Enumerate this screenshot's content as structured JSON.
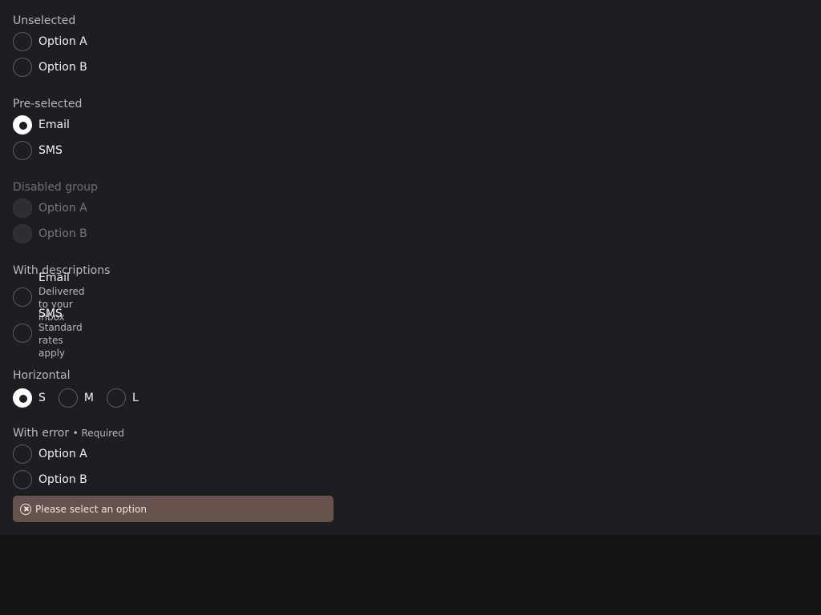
{
  "groups": {
    "unselected": {
      "label": "Unselected",
      "options": [
        "Option A",
        "Option B"
      ]
    },
    "preselected": {
      "label": "Pre-selected",
      "options": [
        "Email",
        "SMS"
      ],
      "selected": "Email"
    },
    "disabled": {
      "label": "Disabled group",
      "options": [
        "Option A",
        "Option B"
      ]
    },
    "descriptions": {
      "label": "With descriptions",
      "options": [
        {
          "title": "Email",
          "desc": "Delivered to your inbox"
        },
        {
          "title": "SMS",
          "desc": "Standard rates apply"
        }
      ]
    },
    "horizontal": {
      "label": "Horizontal",
      "options": [
        "S",
        "M",
        "L"
      ],
      "selected": "S"
    },
    "error": {
      "label": "With error",
      "required": "• Required",
      "options": [
        "Option A",
        "Option B"
      ],
      "message": "Please select an option"
    }
  },
  "icons": {
    "error": "x-circle-icon"
  },
  "colors": {
    "panel_bg": "#1e1d22",
    "page_bg": "#141414",
    "error_bg": "#67514d",
    "selected": "#ffffff"
  }
}
